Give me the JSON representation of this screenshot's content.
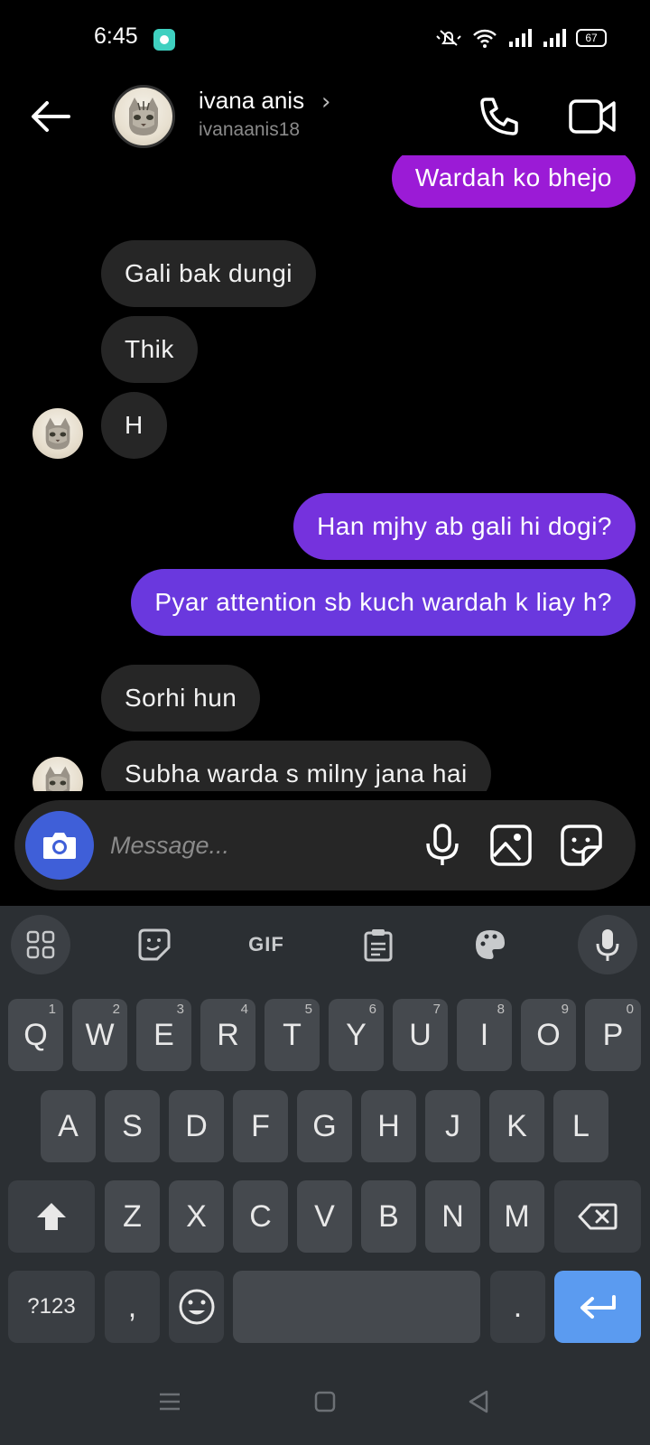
{
  "status_bar": {
    "time": "6:45",
    "battery": "67"
  },
  "header": {
    "name": "ivana anis",
    "handle": "ivanaanis18"
  },
  "messages": [
    {
      "direction": "out",
      "text": "Wardah ko bhejo"
    },
    {
      "direction": "in",
      "text": "Gali bak dungi"
    },
    {
      "direction": "in",
      "text": "Thik"
    },
    {
      "direction": "in",
      "text": "H"
    },
    {
      "direction": "out",
      "text": "Han mjhy ab gali hi dogi?"
    },
    {
      "direction": "out",
      "text": "Pyar attention sb kuch wardah k liay h?"
    },
    {
      "direction": "in",
      "text": "Sorhi hun"
    },
    {
      "direction": "in",
      "text": "Subha warda s milny jana hai"
    }
  ],
  "composer": {
    "placeholder": "Message..."
  },
  "keyboard": {
    "toolbar": {
      "gif_label": "GIF"
    },
    "row1": [
      {
        "key": "Q",
        "hint": "1"
      },
      {
        "key": "W",
        "hint": "2"
      },
      {
        "key": "E",
        "hint": "3"
      },
      {
        "key": "R",
        "hint": "4"
      },
      {
        "key": "T",
        "hint": "5"
      },
      {
        "key": "Y",
        "hint": "6"
      },
      {
        "key": "U",
        "hint": "7"
      },
      {
        "key": "I",
        "hint": "8"
      },
      {
        "key": "O",
        "hint": "9"
      },
      {
        "key": "P",
        "hint": "0"
      }
    ],
    "row2": [
      "A",
      "S",
      "D",
      "F",
      "G",
      "H",
      "J",
      "K",
      "L"
    ],
    "row3": [
      "Z",
      "X",
      "C",
      "V",
      "B",
      "N",
      "M"
    ],
    "symbols_label": "?123",
    "comma": ",",
    "period": "."
  },
  "colors": {
    "outgoing_magenta": "#9b1bd6",
    "outgoing_violet": "#7532dd",
    "incoming_bubble": "#262626",
    "camera_blue": "#3f5fd8",
    "enter_blue": "#5b9bf0"
  }
}
